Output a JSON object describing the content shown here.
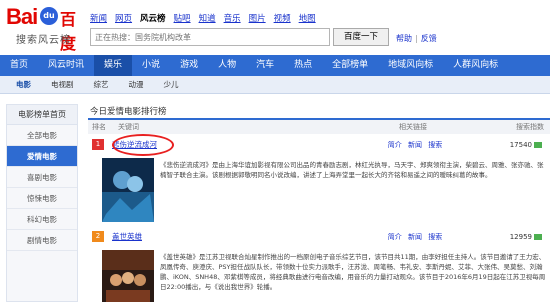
{
  "logo": {
    "latin": "Bai",
    "paw": "du",
    "cn": "百度",
    "subtitle": "搜索风云榜"
  },
  "topnav": [
    {
      "label": "新闻",
      "active": false
    },
    {
      "label": "网页",
      "active": false
    },
    {
      "label": "风云榜",
      "active": true
    },
    {
      "label": "贴吧",
      "active": false
    },
    {
      "label": "知道",
      "active": false
    },
    {
      "label": "音乐",
      "active": false
    },
    {
      "label": "图片",
      "active": false
    },
    {
      "label": "视频",
      "active": false
    },
    {
      "label": "地图",
      "active": false
    }
  ],
  "search": {
    "placeholder": "正在热搜：国务院机构改革",
    "button": "百度一下",
    "help": "帮助",
    "feedback": "反馈"
  },
  "mainnav": [
    {
      "label": "首页"
    },
    {
      "label": "风云时讯"
    },
    {
      "label": "娱乐"
    },
    {
      "label": "小说"
    },
    {
      "label": "游戏"
    },
    {
      "label": "人物"
    },
    {
      "label": "汽车"
    },
    {
      "label": "热点"
    },
    {
      "label": "全部榜单"
    },
    {
      "label": "地域风向标"
    },
    {
      "label": "人群风向标"
    }
  ],
  "subnav": [
    {
      "label": "电影"
    },
    {
      "label": "电视剧"
    },
    {
      "label": "综艺"
    },
    {
      "label": "动漫"
    },
    {
      "label": "少儿"
    }
  ],
  "sidebar": {
    "title": "电影榜单首页",
    "items": [
      {
        "label": "全部电影"
      },
      {
        "label": "爱情电影"
      },
      {
        "label": "喜剧电影"
      },
      {
        "label": "惊悚电影"
      },
      {
        "label": "科幻电影"
      },
      {
        "label": "剧情电影"
      }
    ]
  },
  "content": {
    "title": "今日爱情电影排行榜",
    "headers": {
      "rank": "排名",
      "keyword": "关键词",
      "related": "相关链接",
      "index": "搜索指数"
    },
    "rows": [
      {
        "rank": "1",
        "keyword": "悲伤逆流成河",
        "links": [
          "简介",
          "新闻",
          "搜索"
        ],
        "index": "17540",
        "desc": "《悲伤逆流成河》是由上海华谊加影视有限公司出品的青春励志剧，林红光执导，马天宇、郑爽领衔主演，柴碧云、周雅、张亦驰、张楠智子联合主演。该剧根据郭敬明同名小说改编，讲述了上海弄堂里一起长大的齐铭和易遥之间的暧昧纠葛的故事。"
      },
      {
        "rank": "2",
        "keyword": "盖世英雄",
        "links": [
          "简介",
          "新闻",
          "搜索"
        ],
        "index": "12959",
        "desc": "《盖世英雄》是江苏卫视联合灿星制作推出的一档原创电子音乐综艺节目，该节目共11期，由李好担任主持人。该节目邀请了王力宏、凤凰传奇、庾澄庆、PSY担任战队队长，带领数十位实力派歌手，汪苏泷、周笔畅、韦礼安、李斯丹妮、艾菲、大张伟、吴莫愁、刘瀚鹏、iKON、SNH48、邓紫棋等成员，将经典歌曲进行电音改编，用音乐的力量打动观众。该节目于2016年6月19日起在江苏卫视每周日22:00播出，与《说出我世界》轮播。"
      }
    ]
  },
  "colors": {
    "brand_blue": "#2e6bd1",
    "brand_red": "#e10602",
    "annotation": "#e82020"
  }
}
